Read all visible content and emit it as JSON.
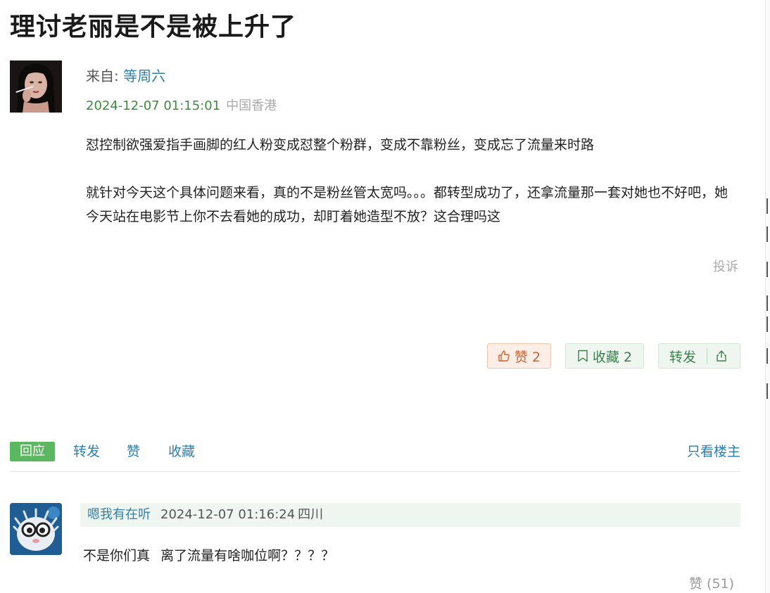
{
  "post": {
    "title": "理讨老丽是不是被上升了",
    "from_label": "来自:",
    "author": "等周六",
    "timestamp": "2024-12-07 01:15:01",
    "location": "中国香港",
    "paragraphs": [
      "怼控制欲强爱指手画脚的红人粉变成怼整个粉群，变成不靠粉丝，变成忘了流量来时路",
      "就针对今天这个具体问题来看，真的不是粉丝管太宽吗。。。都转型成功了，还拿流量那一套对她也不好吧，她今天站在电影节上你不去看她的成功，却盯着她造型不放？这合理吗这"
    ],
    "report_label": "投诉"
  },
  "actions": {
    "like_label": "赞 2",
    "fav_label": "收藏 2",
    "share_label": "转发"
  },
  "tabs": {
    "reply": "回应",
    "forward": "转发",
    "like": "赞",
    "collect": "收藏",
    "owner_only": "只看楼主"
  },
  "comments": [
    {
      "user": "嗯我有在听",
      "timestamp": "2024-12-07 01:16:24",
      "location": "四川",
      "text": "不是你们真    离了流量有啥咖位啊？？？？",
      "like_label": "赞 (51)"
    }
  ],
  "colors": {
    "link": "#2e7fae",
    "timestamp_green": "#3d8b3d",
    "reply_tab_bg": "#5cb860",
    "like_btn_text": "#d2622f",
    "green_btn_text": "#3d7f4e"
  },
  "icons": {
    "like_button": "thumbs-up-icon",
    "fav_button": "bookmark-icon",
    "share_button": "share-icon"
  }
}
